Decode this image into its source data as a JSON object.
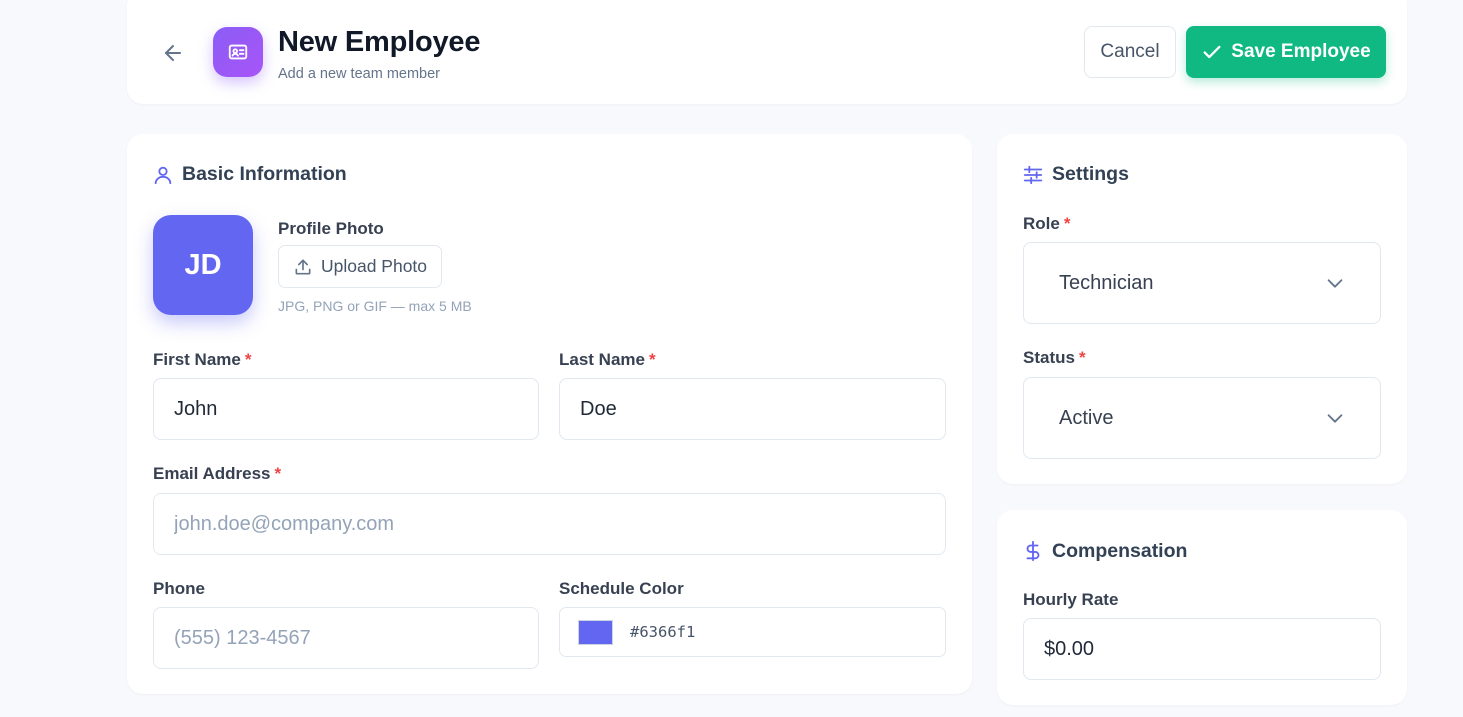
{
  "header": {
    "title": "New Employee",
    "subtitle": "Add a new team member",
    "cancel_label": "Cancel",
    "save_label": "Save Employee"
  },
  "basic_info": {
    "section_title": "Basic Information",
    "avatar_initials": "JD",
    "profile_photo_label": "Profile Photo",
    "upload_label": "Upload Photo",
    "upload_hint": "JPG, PNG or GIF — max 5 MB",
    "first_name": {
      "label": "First Name",
      "value": "John",
      "required": "*"
    },
    "last_name": {
      "label": "Last Name",
      "value": "Doe",
      "required": "*"
    },
    "email": {
      "label": "Email Address",
      "placeholder": "john.doe@company.com",
      "value": "",
      "required": "*"
    },
    "phone": {
      "label": "Phone",
      "placeholder": "(555) 123-4567",
      "value": ""
    },
    "schedule_color": {
      "label": "Schedule Color",
      "value": "#6366f1"
    }
  },
  "settings": {
    "section_title": "Settings",
    "role": {
      "label": "Role",
      "value": "Technician",
      "required": "*"
    },
    "status": {
      "label": "Status",
      "value": "Active",
      "required": "*"
    }
  },
  "compensation": {
    "section_title": "Compensation",
    "hourly_rate": {
      "label": "Hourly Rate",
      "value": "$0.00"
    }
  },
  "colors": {
    "accent": "#6366f1",
    "save_green": "#10b981",
    "logo_purple": "#8b5cf6",
    "required_red": "#ef4444"
  },
  "icons": {
    "back": "arrow-left-icon",
    "logo": "id-card-icon",
    "save": "check-icon",
    "basic": "user-icon",
    "upload": "upload-icon",
    "settings": "sliders-icon",
    "compensation": "dollar-icon",
    "dropdown": "chevron-down-icon"
  }
}
